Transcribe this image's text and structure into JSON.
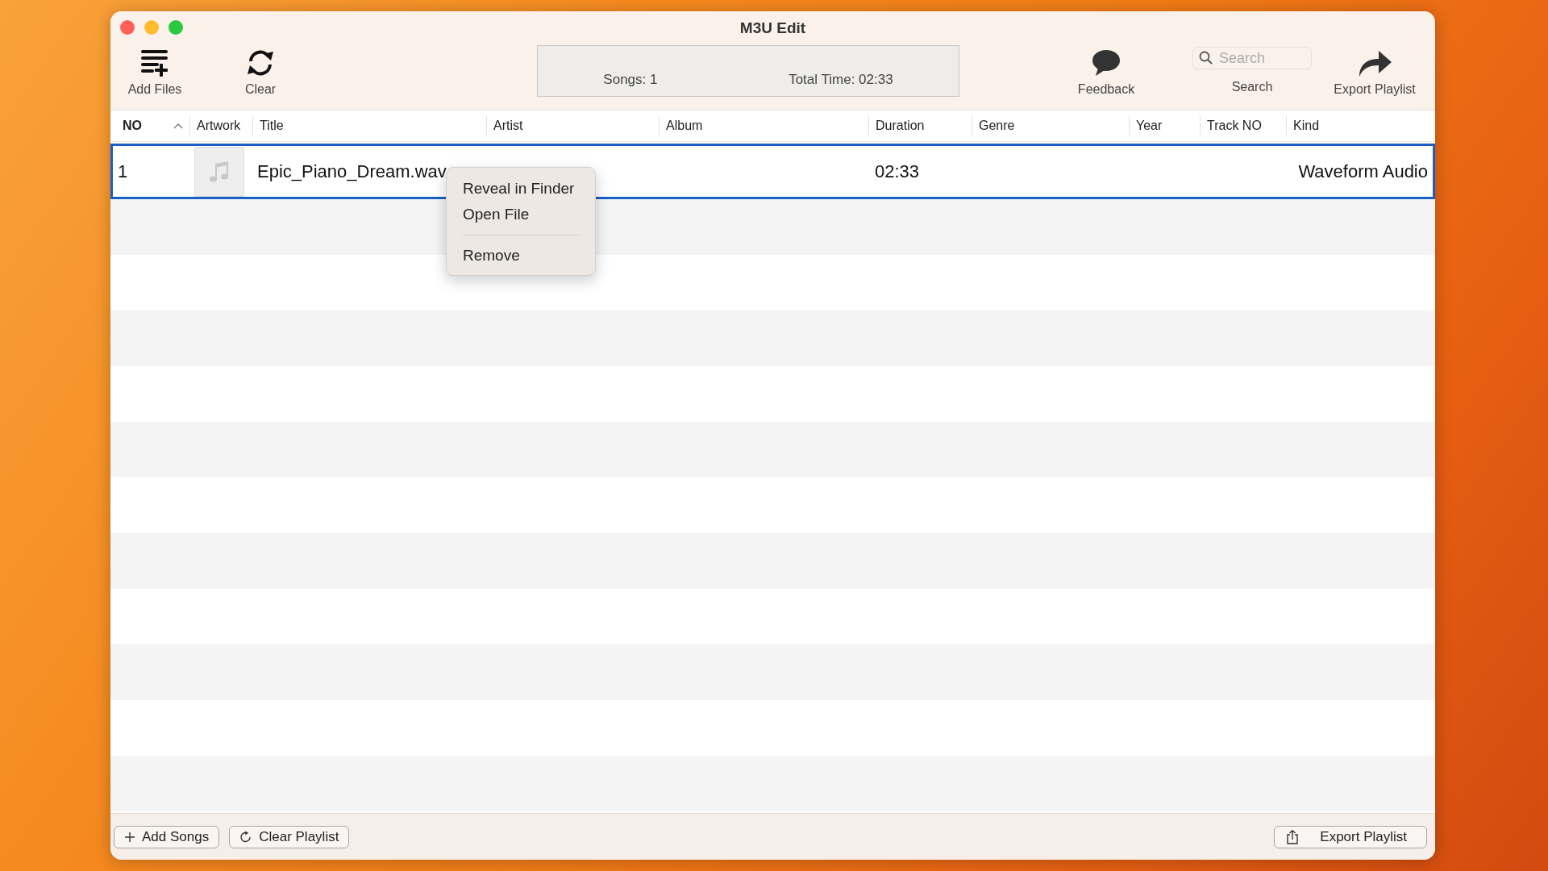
{
  "window": {
    "title": "M3U Edit"
  },
  "toolbar": {
    "items": [
      {
        "kind": "button",
        "label": "Add Files"
      },
      {
        "kind": "button",
        "label": "Clear"
      },
      {
        "kind": "stats",
        "songs": "Songs: 1",
        "total_time": "Total Time: 02:33"
      },
      {
        "kind": "button",
        "label": "Feedback"
      },
      {
        "kind": "search",
        "placeholder": "Search",
        "label": "Search"
      },
      {
        "kind": "button",
        "label": "Export Playlist"
      }
    ]
  },
  "table": {
    "columns": [
      {
        "label": "NO",
        "sorted": true
      },
      {
        "label": "Artwork",
        "sorted": false
      },
      {
        "label": "Title",
        "sorted": false
      },
      {
        "label": "Artist",
        "sorted": false
      },
      {
        "label": "Album",
        "sorted": false
      },
      {
        "label": "Duration",
        "sorted": false
      },
      {
        "label": "Genre",
        "sorted": false
      },
      {
        "label": "Year",
        "sorted": false
      },
      {
        "label": "Track NO",
        "sorted": false
      },
      {
        "label": "Kind",
        "sorted": false
      }
    ],
    "rows": [
      {
        "selected": true,
        "no": "1",
        "title": "Epic_Piano_Dream.wav",
        "duration": "02:33",
        "file_kind": "Waveform Audio"
      }
    ]
  },
  "context_menu": {
    "items": [
      {
        "kind": "item",
        "label": "Reveal in Finder"
      },
      {
        "kind": "item",
        "label": "Open File"
      },
      {
        "kind": "separator"
      },
      {
        "kind": "item",
        "label": "Remove"
      }
    ]
  },
  "bottom_bar": {
    "left_buttons": [
      {
        "label": "Add Songs"
      },
      {
        "label": "Clear Playlist"
      }
    ],
    "right_button": {
      "label": "Export Playlist"
    }
  }
}
